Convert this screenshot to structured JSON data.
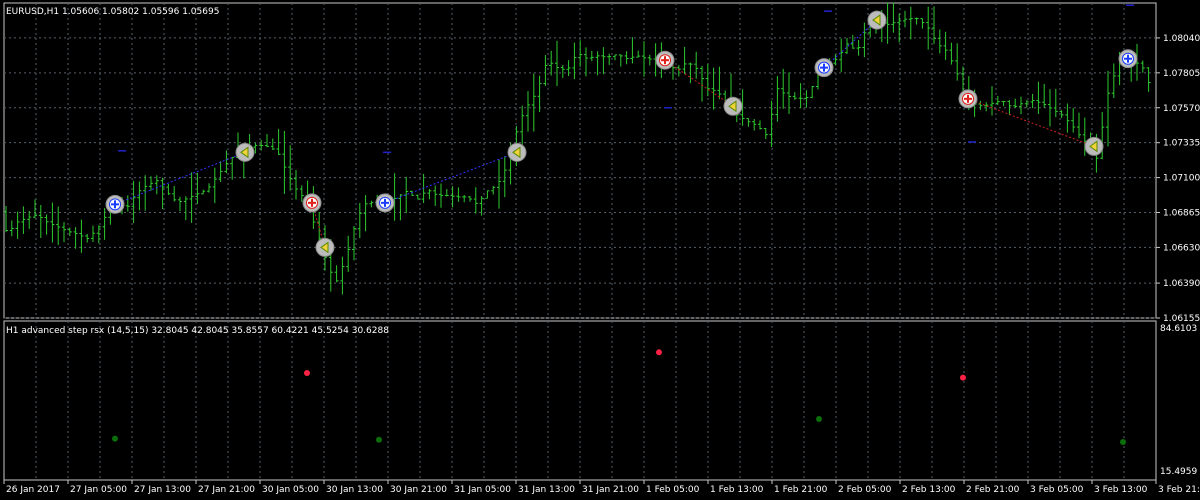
{
  "main": {
    "header": "EURUSD,H1  1.05606 1.05802 1.05596 1.05695",
    "y_min": 1.06155,
    "y_max": 1.08275,
    "y_ticks": [
      "1.08040",
      "1.07805",
      "1.07570",
      "1.07335",
      "1.07100",
      "1.06865",
      "1.06630",
      "1.06390",
      "1.06155"
    ],
    "bar_color": "#2ecc2e",
    "trend_up_color": "#3333ff",
    "trend_down_color": "#cc2222"
  },
  "indicator": {
    "header": "H1 advanced step rsx (14,5,15) 32.8045 42.8045 35.8557 60.4221 45.5254 30.6288",
    "y_top_label": "84.6103",
    "y_bottom_label": "15.4959",
    "y_min": 15.4959,
    "y_max": 84.6103
  },
  "x_labels": [
    "26 Jan 2017",
    "27 Jan 05:00",
    "27 Jan 13:00",
    "27 Jan 21:00",
    "30 Jan 05:00",
    "30 Jan 13:00",
    "30 Jan 21:00",
    "31 Jan 05:00",
    "31 Jan 13:00",
    "31 Jan 21:00",
    "1 Feb 05:00",
    "1 Feb 13:00",
    "1 Feb 21:00",
    "2 Feb 05:00",
    "2 Feb 13:00",
    "2 Feb 21:00",
    "3 Feb 05:00",
    "3 Feb 13:00",
    "3 Feb 21:00"
  ],
  "chart_data": {
    "type": "ohlc",
    "symbol": "EURUSD",
    "timeframe": "H1",
    "path": [
      [
        0,
        1.0694
      ],
      [
        10,
        1.0672
      ],
      [
        20,
        1.068
      ],
      [
        30,
        1.0683
      ],
      [
        40,
        1.0685
      ],
      [
        50,
        1.068
      ],
      [
        60,
        1.0677
      ],
      [
        70,
        1.0674
      ],
      [
        80,
        1.0672
      ],
      [
        90,
        1.0669
      ],
      [
        100,
        1.0675
      ],
      [
        110,
        1.0686
      ],
      [
        115,
        1.0692
      ],
      [
        120,
        1.0692
      ],
      [
        130,
        1.069
      ],
      [
        140,
        1.07
      ],
      [
        150,
        1.0705
      ],
      [
        160,
        1.0708
      ],
      [
        170,
        1.07
      ],
      [
        180,
        1.0693
      ],
      [
        190,
        1.0696
      ],
      [
        200,
        1.0699
      ],
      [
        210,
        1.0702
      ],
      [
        220,
        1.0711
      ],
      [
        230,
        1.072
      ],
      [
        240,
        1.0727
      ],
      [
        250,
        1.073
      ],
      [
        260,
        1.0732
      ],
      [
        270,
        1.0731
      ],
      [
        280,
        1.0728
      ],
      [
        290,
        1.0713
      ],
      [
        300,
        1.0701
      ],
      [
        312,
        1.0693
      ],
      [
        318,
        1.0675
      ],
      [
        325,
        1.0665
      ],
      [
        330,
        1.065
      ],
      [
        340,
        1.064
      ],
      [
        350,
        1.0659
      ],
      [
        360,
        1.0683
      ],
      [
        370,
        1.0694
      ],
      [
        380,
        1.0692
      ],
      [
        385,
        1.0693
      ],
      [
        390,
        1.0693
      ],
      [
        400,
        1.0697
      ],
      [
        410,
        1.0701
      ],
      [
        420,
        1.0695
      ],
      [
        430,
        1.0702
      ],
      [
        440,
        1.0698
      ],
      [
        450,
        1.0698
      ],
      [
        460,
        1.0697
      ],
      [
        470,
        1.0697
      ],
      [
        480,
        1.0692
      ],
      [
        490,
        1.0701
      ],
      [
        500,
        1.0705
      ],
      [
        510,
        1.0718
      ],
      [
        517,
        1.0727
      ],
      [
        520,
        1.0745
      ],
      [
        530,
        1.0758
      ],
      [
        540,
        1.0768
      ],
      [
        550,
        1.0789
      ],
      [
        560,
        1.0784
      ],
      [
        570,
        1.0782
      ],
      [
        580,
        1.0794
      ],
      [
        590,
        1.079
      ],
      [
        600,
        1.0792
      ],
      [
        610,
        1.0791
      ],
      [
        620,
        1.0793
      ],
      [
        630,
        1.079
      ],
      [
        640,
        1.0792
      ],
      [
        650,
        1.079
      ],
      [
        665,
        1.0789
      ],
      [
        680,
        1.0782
      ],
      [
        690,
        1.0788
      ],
      [
        700,
        1.0783
      ],
      [
        710,
        1.077
      ],
      [
        720,
        1.0768
      ],
      [
        733,
        1.0758
      ],
      [
        740,
        1.0752
      ],
      [
        750,
        1.0748
      ],
      [
        760,
        1.0745
      ],
      [
        770,
        1.0738
      ],
      [
        780,
        1.077
      ],
      [
        790,
        1.0765
      ],
      [
        800,
        1.0763
      ],
      [
        810,
        1.0764
      ],
      [
        824,
        1.0784
      ],
      [
        830,
        1.0786
      ],
      [
        840,
        1.079
      ],
      [
        850,
        1.08
      ],
      [
        860,
        1.0795
      ],
      [
        870,
        1.0812
      ],
      [
        877,
        1.0816
      ],
      [
        880,
        1.0815
      ],
      [
        890,
        1.0813
      ],
      [
        900,
        1.0815
      ],
      [
        910,
        1.0817
      ],
      [
        920,
        1.0817
      ],
      [
        930,
        1.0812
      ],
      [
        940,
        1.08
      ],
      [
        950,
        1.0795
      ],
      [
        960,
        1.078
      ],
      [
        968,
        1.0763
      ],
      [
        975,
        1.076
      ],
      [
        985,
        1.0758
      ],
      [
        995,
        1.076
      ],
      [
        1005,
        1.0762
      ],
      [
        1015,
        1.0757
      ],
      [
        1025,
        1.076
      ],
      [
        1035,
        1.0762
      ],
      [
        1045,
        1.076
      ],
      [
        1055,
        1.0756
      ],
      [
        1065,
        1.0752
      ],
      [
        1075,
        1.0745
      ],
      [
        1085,
        1.0736
      ],
      [
        1094,
        1.0731
      ],
      [
        1100,
        1.0722
      ],
      [
        1110,
        1.0765
      ],
      [
        1120,
        1.0785
      ],
      [
        1128,
        1.079
      ],
      [
        1135,
        1.0789
      ],
      [
        1145,
        1.0785
      ],
      [
        1155,
        1.0768
      ]
    ],
    "signals": [
      {
        "i": 115,
        "price": 1.0692,
        "kind": "buy"
      },
      {
        "i": 245,
        "price": 1.0727,
        "kind": "exit"
      },
      {
        "i": 312,
        "price": 1.0693,
        "kind": "sell"
      },
      {
        "i": 325,
        "price": 1.0663,
        "kind": "exit"
      },
      {
        "i": 385,
        "price": 1.0693,
        "kind": "buy"
      },
      {
        "i": 517,
        "price": 1.0727,
        "kind": "exit"
      },
      {
        "i": 665,
        "price": 1.0789,
        "kind": "sell"
      },
      {
        "i": 733,
        "price": 1.0758,
        "kind": "exit"
      },
      {
        "i": 824,
        "price": 1.0784,
        "kind": "buy"
      },
      {
        "i": 877,
        "price": 1.0816,
        "kind": "exit"
      },
      {
        "i": 968,
        "price": 1.0763,
        "kind": "sell"
      },
      {
        "i": 1094,
        "price": 1.0731,
        "kind": "exit"
      },
      {
        "i": 1128,
        "price": 1.079,
        "kind": "buy"
      }
    ],
    "trend_lines": [
      {
        "from": [
          115,
          1.0692
        ],
        "to": [
          245,
          1.0727
        ],
        "kind": "up"
      },
      {
        "from": [
          312,
          1.0693
        ],
        "to": [
          325,
          1.0663
        ],
        "kind": "down"
      },
      {
        "from": [
          385,
          1.0693
        ],
        "to": [
          517,
          1.0727
        ],
        "kind": "up"
      },
      {
        "from": [
          665,
          1.0789
        ],
        "to": [
          733,
          1.0758
        ],
        "kind": "down"
      },
      {
        "from": [
          824,
          1.0784
        ],
        "to": [
          877,
          1.0816
        ],
        "kind": "up"
      },
      {
        "from": [
          968,
          1.0763
        ],
        "to": [
          1094,
          1.0731
        ],
        "kind": "down"
      }
    ],
    "dashes": [
      {
        "i": 122,
        "price": 1.0728
      },
      {
        "i": 387,
        "price": 1.0727
      },
      {
        "i": 668,
        "price": 1.0757
      },
      {
        "i": 828,
        "price": 1.0822
      },
      {
        "i": 972,
        "price": 1.0734
      },
      {
        "i": 1130,
        "price": 1.0826
      }
    ],
    "indicator_points": [
      {
        "i": 115,
        "value": 33.5,
        "color": "#0a6e0a"
      },
      {
        "i": 307,
        "value": 62.0,
        "color": "#ff2244"
      },
      {
        "i": 379,
        "value": 33.0,
        "color": "#0a6e0a"
      },
      {
        "i": 659,
        "value": 71.0,
        "color": "#ff2244"
      },
      {
        "i": 819,
        "value": 42.0,
        "color": "#0a6e0a"
      },
      {
        "i": 963,
        "value": 60.0,
        "color": "#ff2244"
      },
      {
        "i": 1123,
        "value": 32.0,
        "color": "#0a6e0a"
      }
    ]
  }
}
